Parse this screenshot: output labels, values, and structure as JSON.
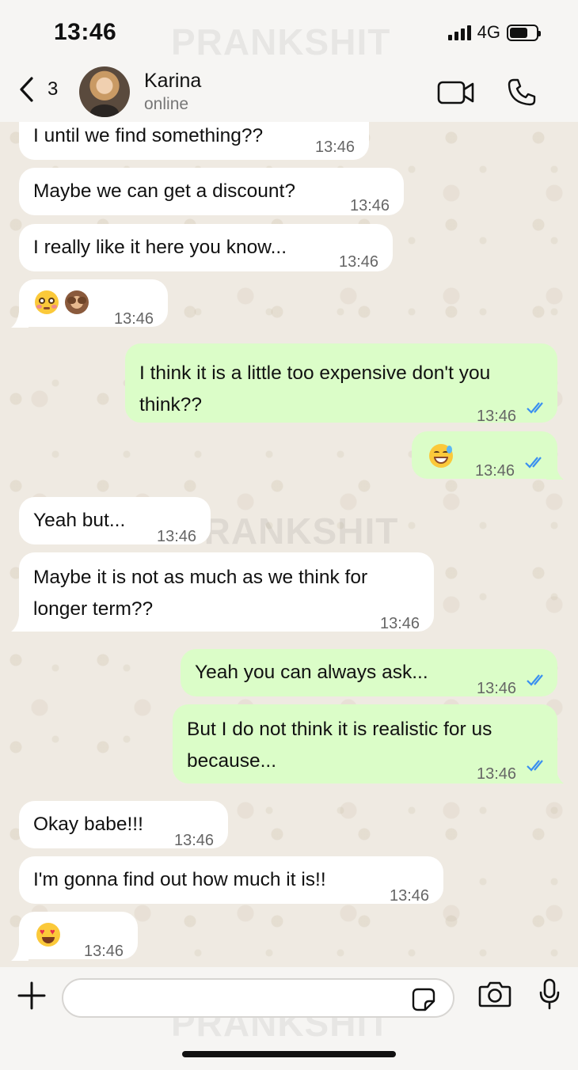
{
  "status_bar": {
    "time": "13:46",
    "network": "4G",
    "battery_level": 0.7
  },
  "watermark": "PRANKSHIT",
  "header": {
    "back_count": "3",
    "contact_name": "Karina",
    "contact_status": "online"
  },
  "messages": [
    {
      "direction": "in",
      "text": "I until we find something??",
      "time": "13:46"
    },
    {
      "direction": "in",
      "text": "Maybe we can get a discount?",
      "time": "13:46"
    },
    {
      "direction": "in",
      "text": "I really like it here you know...",
      "time": "13:46"
    },
    {
      "direction": "in",
      "emojis": [
        "flushed-face-emoji",
        "see-no-evil-monkey-emoji"
      ],
      "time": "13:46"
    },
    {
      "direction": "out",
      "text": "I think it is a little too expensive don't you think??",
      "time": "13:46",
      "read": true
    },
    {
      "direction": "out",
      "emojis": [
        "grinning-sweat-emoji"
      ],
      "time": "13:46",
      "read": true
    },
    {
      "direction": "in",
      "text": "Yeah but...",
      "time": "13:46"
    },
    {
      "direction": "in",
      "text": "Maybe it is not as much as we think for longer term??",
      "time": "13:46"
    },
    {
      "direction": "out",
      "text": "Yeah you can always ask...",
      "time": "13:46",
      "read": true
    },
    {
      "direction": "out",
      "text": "But I do not think it is realistic for us because...",
      "time": "13:46",
      "read": true
    },
    {
      "direction": "in",
      "text": "Okay babe!!!",
      "time": "13:46"
    },
    {
      "direction": "in",
      "text": "I'm gonna find out how much it is!!",
      "time": "13:46"
    },
    {
      "direction": "in",
      "emojis": [
        "heart-eyes-emoji"
      ],
      "time": "13:46"
    }
  ],
  "composer": {
    "input_value": "",
    "placeholder": ""
  },
  "colors": {
    "incoming_bubble": "#ffffff",
    "outgoing_bubble": "#dbfdc8",
    "read_ticks": "#3a8ff0",
    "chat_background": "#efeae2"
  },
  "icons": {
    "back": "chevron-left-icon",
    "video": "video-camera-icon",
    "phone": "phone-icon",
    "plus": "plus-icon",
    "sticker": "sticker-icon",
    "camera": "camera-icon",
    "mic": "microphone-icon",
    "read": "double-check-icon"
  }
}
